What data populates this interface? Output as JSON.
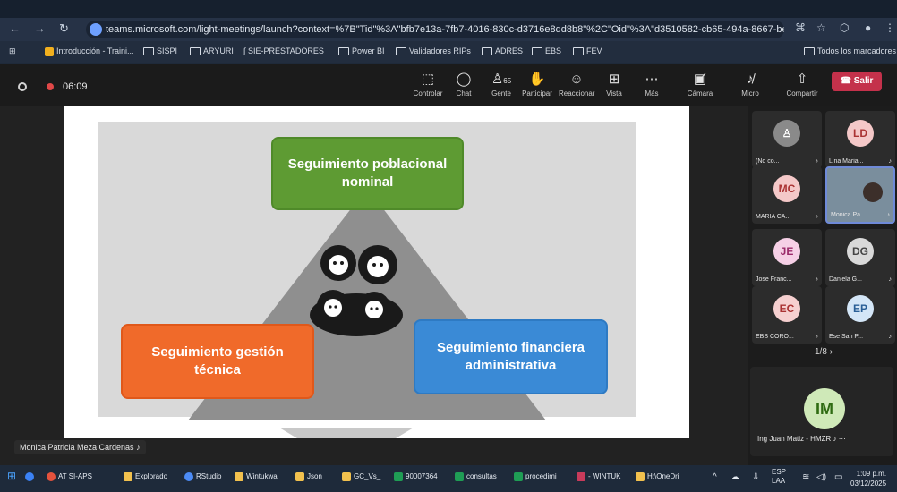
{
  "browser": {
    "url": "teams.microsoft.com/light-meetings/launch?context=%7B\"Tid\"%3A\"bfb7e13a-7fb7-4016-830c-d3716e8dd8b8\"%2C\"Oid\"%3A\"d3510582-cb65-494a-8667-be...",
    "bookmarks": [
      "Introducción - Traini...",
      "SISPI",
      "ARYURI",
      "SIE-PRESTADORES",
      "Power BI",
      "Validadores RIPs",
      "ADRES",
      "EBS",
      "FEV"
    ],
    "all_bookmarks": "Todos los marcadores"
  },
  "meeting": {
    "timer": "06:09",
    "tools": [
      "Controlar",
      "Chat",
      "Gente",
      "Participar",
      "Reaccionar",
      "Vista",
      "Más",
      "Cámara",
      "Micro",
      "Compartir"
    ],
    "people_count": "65",
    "leave_label": "Salir"
  },
  "slide": {
    "top": "Seguimiento poblacional nominal",
    "left": "Seguimiento gestión técnica",
    "right": "Seguimiento financiera administrativa"
  },
  "speaker": "Monica Patricia Meza Cardenas",
  "participants": [
    {
      "initials": "",
      "name": "(No co...",
      "bg": "#8a8a8a",
      "fg": "#ffffff"
    },
    {
      "initials": "LD",
      "name": "Lina Maria...",
      "bg": "#f4c8c8",
      "fg": "#a33"
    },
    {
      "initials": "MC",
      "name": "MARIA CA...",
      "bg": "#f4c8c8",
      "fg": "#a33"
    },
    {
      "initials": "",
      "name": "Monica Pa...",
      "bg": "#9fb6c8",
      "fg": "#fff"
    },
    {
      "initials": "JE",
      "name": "Jose Franc...",
      "bg": "#f6d0e6",
      "fg": "#9b2a6a"
    },
    {
      "initials": "DG",
      "name": "Daniela G...",
      "bg": "#d9d9d9",
      "fg": "#444"
    },
    {
      "initials": "EC",
      "name": "EBS CORO...",
      "bg": "#f6d0d0",
      "fg": "#a33"
    },
    {
      "initials": "EP",
      "name": "Ese San P...",
      "bg": "#d4e6f7",
      "fg": "#2a5f96"
    }
  ],
  "pager": "1/8",
  "featured": {
    "initials": "IM",
    "name": "Ing Juan Matiz - HMZR"
  },
  "taskbar": {
    "items": [
      "AT SI-APS",
      "Explorado",
      "RStudio",
      "Wintukwa",
      "Json",
      "GC_Vs_",
      "90007364",
      "consultas",
      "procedimi",
      "- WINTUK",
      "H:\\OneDri"
    ],
    "lang1": "ESP",
    "lang2": "LAA",
    "time": "1:09 p.m.",
    "date": "03/12/2025"
  }
}
